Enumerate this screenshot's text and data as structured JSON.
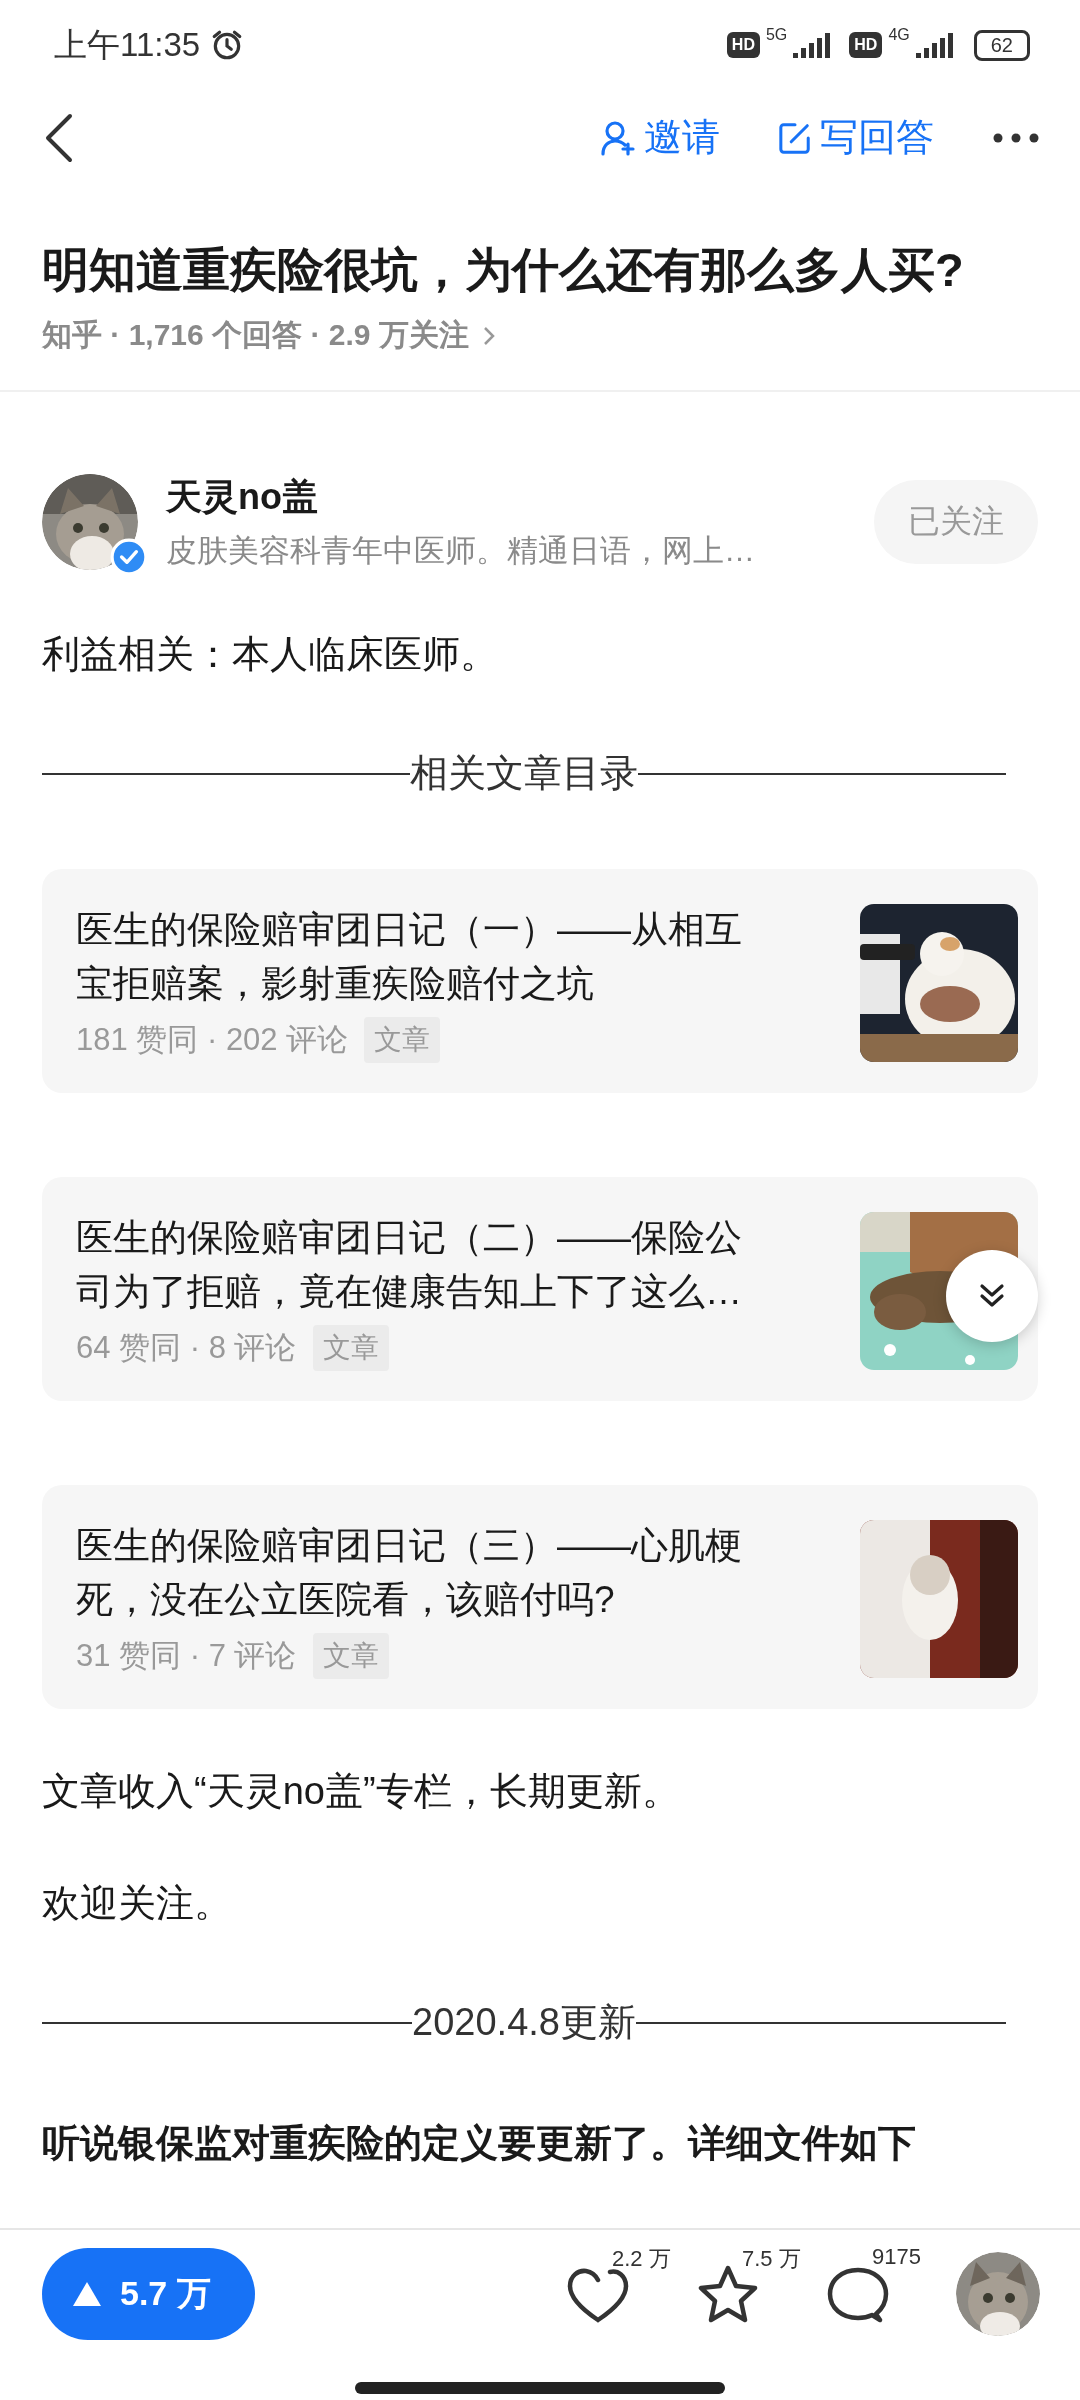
{
  "status_bar": {
    "time": "上午11:35",
    "networks": [
      {
        "badge": "HD",
        "generation": "5G"
      },
      {
        "badge": "HD",
        "generation": "4G"
      }
    ],
    "battery": "62"
  },
  "toolbar": {
    "actions": [
      {
        "kind": "invite",
        "label": "邀请"
      },
      {
        "kind": "write",
        "label": "写回答"
      }
    ]
  },
  "question": {
    "title": "明知道重疾险很坑，为什么还有那么多人买?",
    "meta": "知乎 · 1,716 个回答 · 2.9 万关注"
  },
  "author": {
    "name": "天灵no盖",
    "bio": "皮肤美容科青年中医师。精通日语，网上…",
    "verified": true,
    "follow_button": "已关注"
  },
  "content": [
    {
      "kind": "paragraph",
      "text": "利益相关：本人临床医师。"
    },
    {
      "kind": "divider",
      "text": "相关文章目录"
    },
    {
      "kind": "card",
      "title": "医生的保险赔审团日记（一）——从相互宝拒赔案，影射重疾险赔付之坑",
      "stats": "181 赞同 · 202 评论",
      "tag": "文章"
    },
    {
      "kind": "card",
      "title": "医生的保险赔审团日记（二）——保险公司为了拒赔，竟在健康告知上下了这么…",
      "stats": "64 赞同 · 8 评论",
      "tag": "文章"
    },
    {
      "kind": "card",
      "title": "医生的保险赔审团日记（三）——心肌梗死，没在公立医院看，该赔付吗?",
      "stats": "31 赞同 · 7 评论",
      "tag": "文章"
    },
    {
      "kind": "paragraph",
      "text": "文章收入“天灵no盖”专栏，长期更新。"
    },
    {
      "kind": "paragraph",
      "text": "欢迎关注。"
    },
    {
      "kind": "divider",
      "text": "2020.4.8更新"
    },
    {
      "kind": "bold_paragraph",
      "text": "听说银保监对重疾险的定义要更新了。详细文件如下"
    }
  ],
  "bottom_bar": {
    "upvote": "5.7 万",
    "actions": [
      {
        "kind": "like",
        "count": "2.2 万"
      },
      {
        "kind": "favorite",
        "count": "7.5 万"
      },
      {
        "kind": "comment",
        "count": "9175"
      }
    ]
  }
}
